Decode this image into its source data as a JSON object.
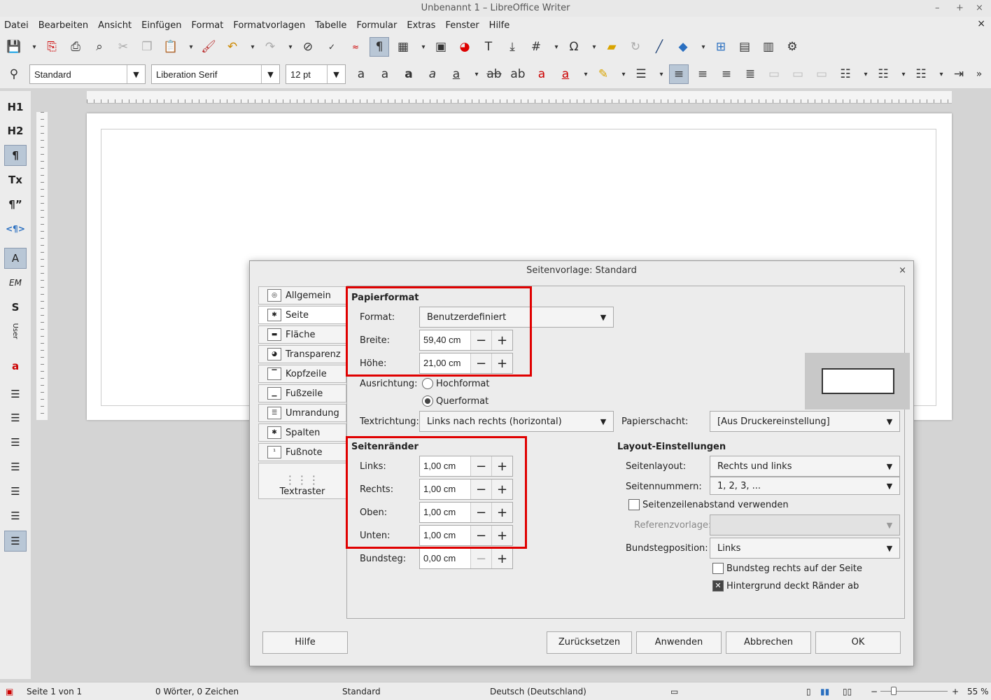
{
  "window": {
    "title": "Unbenannt 1 – LibreOffice Writer",
    "min": "–",
    "max": "+",
    "close": "×"
  },
  "menu": [
    "Datei",
    "Bearbeiten",
    "Ansicht",
    "Einfügen",
    "Format",
    "Formatvorlagen",
    "Tabelle",
    "Formular",
    "Extras",
    "Fenster",
    "Hilfe"
  ],
  "doc_close": "×",
  "toolbar2": {
    "paragraph_style": "Standard",
    "font_name": "Liberation Serif",
    "font_size": "12 pt"
  },
  "sidebar": {
    "h1": "H1",
    "h2": "H2",
    "para": "¶",
    "tx": "Tx",
    "quote": "¶”",
    "rtl": "<¶>",
    "a": "A",
    "em": "EM",
    "s": "S",
    "user": "User"
  },
  "dialog": {
    "title": "Seitenvorlage: Standard",
    "close": "×",
    "tabs": [
      "Allgemein",
      "Seite",
      "Fläche",
      "Transparenz",
      "Kopfzeile",
      "Fußzeile",
      "Umrandung",
      "Spalten",
      "Fußnote",
      "Textraster"
    ],
    "papierformat": {
      "header": "Papierformat",
      "format_label": "Format:",
      "format_value": "Benutzerdefiniert",
      "breite_label": "Breite:",
      "breite_value": "59,40 cm",
      "hoehe_label": "Höhe:",
      "hoehe_value": "21,00 cm",
      "ausrichtung_label": "Ausrichtung:",
      "hochformat": "Hochformat",
      "querformat": "Querformat",
      "orientation": "Querformat",
      "textrichtung_label": "Textrichtung:",
      "textrichtung_value": "Links nach rechts (horizontal)",
      "papierschacht_label": "Papierschacht:",
      "papierschacht_value": "[Aus Druckereinstellung]"
    },
    "seitenraender": {
      "header": "Seitenränder",
      "links_label": "Links:",
      "links_value": "1,00 cm",
      "rechts_label": "Rechts:",
      "rechts_value": "1,00 cm",
      "oben_label": "Oben:",
      "oben_value": "1,00 cm",
      "unten_label": "Unten:",
      "unten_value": "1,00 cm",
      "bundsteg_label": "Bundsteg:",
      "bundsteg_value": "0,00 cm"
    },
    "layout": {
      "header": "Layout-Einstellungen",
      "seitenlayout_label": "Seitenlayout:",
      "seitenlayout_value": "Rechts und links",
      "seitennummern_label": "Seitennummern:",
      "seitennummern_value": "1, 2, 3, ...",
      "seitenzeilen_label": "Seitenzeilenabstand verwenden",
      "referenz_label": "Referenzvorlage:",
      "bundstegpos_label": "Bundstegposition:",
      "bundstegpos_value": "Links",
      "bundsteg_rechts_label": "Bundsteg rechts auf der Seite",
      "hintergrund_label": "Hintergrund deckt Ränder ab"
    },
    "buttons": {
      "help": "Hilfe",
      "reset": "Zurücksetzen",
      "apply": "Anwenden",
      "cancel": "Abbrechen",
      "ok": "OK"
    }
  },
  "status": {
    "page": "Seite 1 von 1",
    "words": "0 Wörter, 0 Zeichen",
    "style": "Standard",
    "language": "Deutsch (Deutschland)",
    "zoom": "55 %"
  },
  "colors": {
    "highlight": "#e00000",
    "accent": "#b9c7d6"
  }
}
